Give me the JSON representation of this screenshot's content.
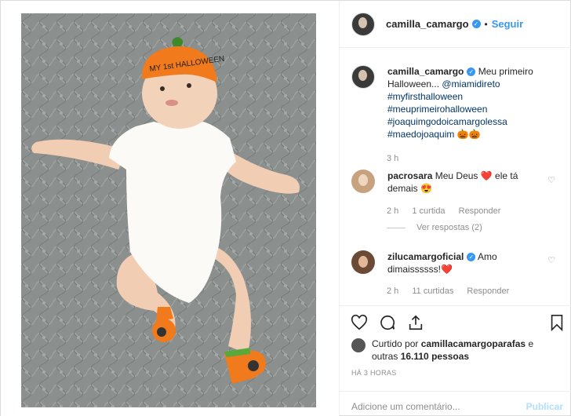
{
  "header": {
    "username": "camilla_camargo",
    "separator": "•",
    "follow_label": "Seguir"
  },
  "caption": {
    "username": "camilla_camargo",
    "text": "Meu primeiro Halloween... ",
    "mention": "@miamidireto",
    "hashtags": [
      "#myfirsthalloween",
      "#meuprimeirohalloween",
      "#joaquimgodoicamargolessa",
      "#maedojoaquim"
    ],
    "emoji": "🎃🎃",
    "time": "3 h"
  },
  "comments": [
    {
      "username": "pacrosara",
      "text_before": "Meu Deus ",
      "emoji_mid": "❤️",
      "text_after": " ele tá demais ",
      "emoji_end": "😍",
      "time": "2 h",
      "likes": "1 curtida",
      "reply": "Responder",
      "view_replies": "Ver respostas (2)"
    },
    {
      "username": "zilucamargoficial",
      "text_before": "Amo dimaissssss!",
      "emoji_end": "❤️",
      "time": "2 h",
      "likes": "11 curtidas",
      "reply": "Responder"
    }
  ],
  "likes_section": {
    "prefix": "Curtido por ",
    "user": "camillacamargoparafas",
    "middle": " e outras ",
    "count": "16.110 pessoas",
    "time_ago": "HÁ 3 HORAS"
  },
  "add_comment": {
    "placeholder": "Adicione um comentário...",
    "publish": "Publicar"
  },
  "icons": {
    "like": "heart-icon",
    "comment": "comment-icon",
    "share": "share-icon",
    "save": "bookmark-icon"
  },
  "colors": {
    "accent": "#3897f0",
    "hashtag": "#003569",
    "muted": "#8e8e8e",
    "publish_disabled": "#b2dffc"
  }
}
